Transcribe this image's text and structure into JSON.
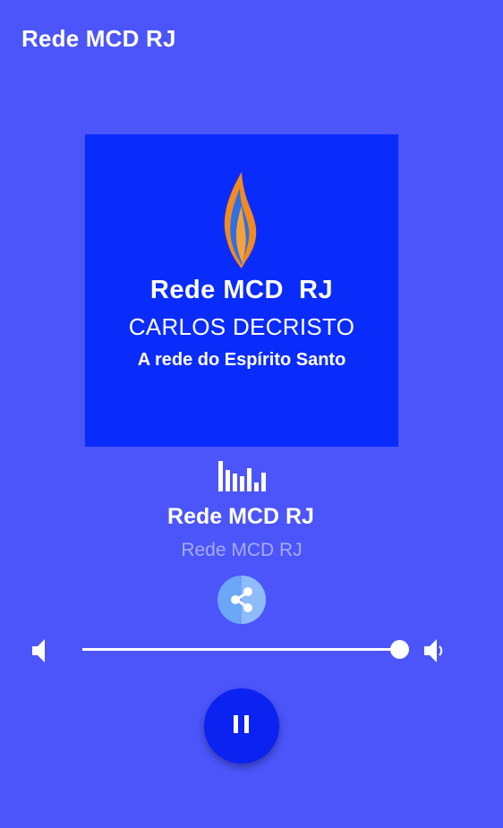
{
  "header": {
    "title": "Rede MCD RJ"
  },
  "cover": {
    "line1": "Rede MCD  RJ",
    "line2": "CARLOS DECRISTO",
    "line3": "A rede do Espírito Santo",
    "logo_icon": "flame-logo"
  },
  "now_playing": {
    "station_name": "Rede MCD RJ",
    "station_subtitle": "Rede MCD RJ",
    "visualizer_icon": "equalizer-icon"
  },
  "controls": {
    "share_icon": "share-icon",
    "volume_level": 0.99,
    "volume_low_icon": "volume-low-icon",
    "volume_high_icon": "volume-high-icon",
    "playback_state": "playing",
    "pause_icon": "pause-icon"
  },
  "colors": {
    "background": "#4b55f9",
    "cover_background": "#0a2cfb",
    "play_button": "#0c22f0",
    "share_button": "#6ba6f7",
    "subtitle": "#a6acf8"
  }
}
